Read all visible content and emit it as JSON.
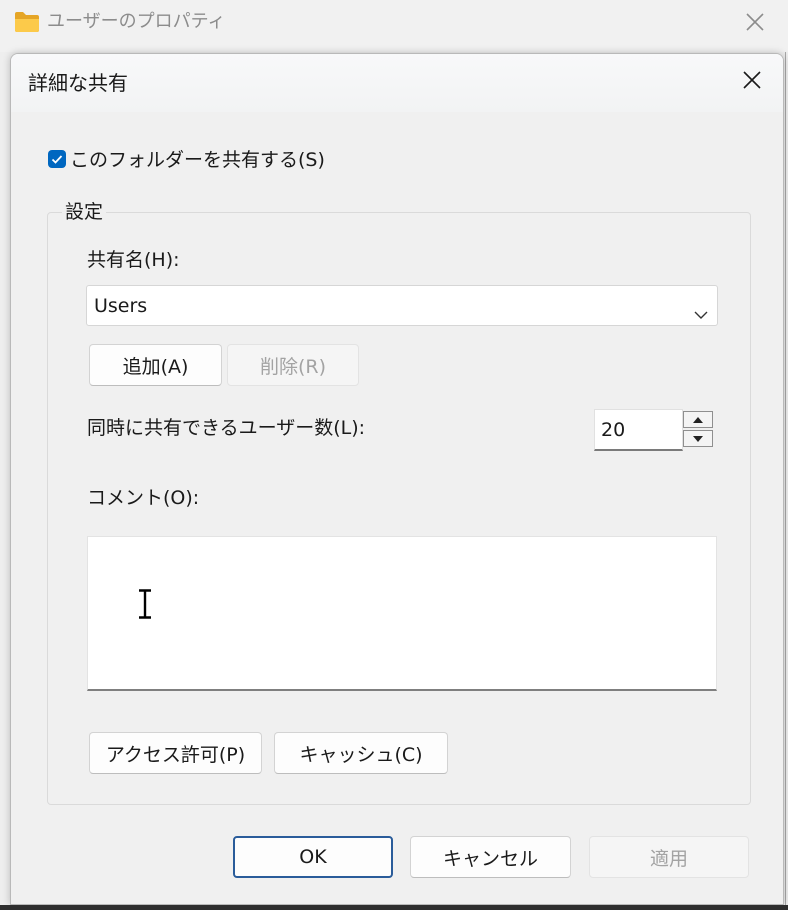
{
  "colors": {
    "accent": "#0067c0"
  },
  "outer_window": {
    "title": "ユーザーのプロパティ",
    "icon": "folder-icon",
    "close_icon": "close-icon"
  },
  "dialog": {
    "title": "詳細な共有",
    "close_icon": "close-icon",
    "share_checkbox": {
      "label": "このフォルダーを共有する(S)",
      "checked": true
    },
    "settings": {
      "group_label": "設定",
      "share_name_label": "共有名(H):",
      "share_name_value": "Users",
      "add_button": {
        "label": "追加(A)",
        "enabled": true
      },
      "remove_button": {
        "label": "削除(R)",
        "enabled": false
      },
      "user_limit_label": "同時に共有できるユーザー数(L):",
      "user_limit_value": "20",
      "comment_label": "コメント(O):",
      "permissions_button": {
        "label": "アクセス許可(P)",
        "enabled": true
      },
      "caching_button": {
        "label": "キャッシュ(C)",
        "enabled": true
      }
    },
    "footer": {
      "ok_button": {
        "label": "OK",
        "enabled": true
      },
      "cancel_button": {
        "label": "キャンセル",
        "enabled": true
      },
      "apply_button": {
        "label": "適用",
        "enabled": false
      }
    }
  }
}
